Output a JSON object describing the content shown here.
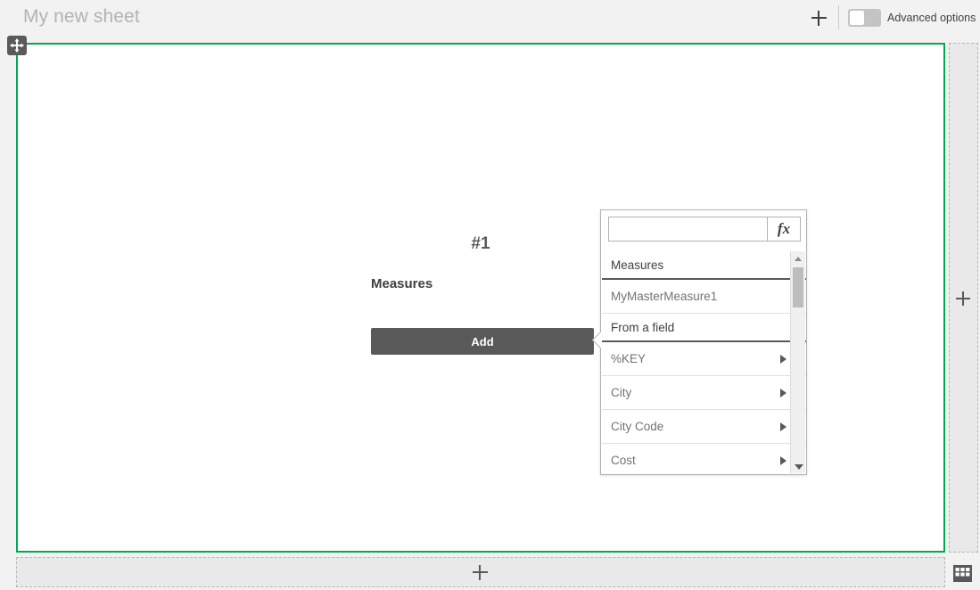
{
  "header": {
    "sheet_title": "My new sheet",
    "add_sheet_icon": "plus-icon",
    "advanced_options_label": "Advanced options",
    "advanced_options_state": "off"
  },
  "canvas": {
    "move_handle_icon": "move-arrows-icon",
    "border_color": "#00a94f",
    "object": {
      "title": "#1",
      "section_label": "Measures",
      "add_button_label": "Add"
    }
  },
  "dropzones": {
    "right_label": "+",
    "bottom_label": "+",
    "right_icon": "plus-icon",
    "bottom_icon": "plus-icon"
  },
  "footer": {
    "grid_icon": "grid-table-icon"
  },
  "popover": {
    "search_value": "",
    "search_placeholder": "",
    "expression_button_label": "fx",
    "expression_button_icon": "fx-icon",
    "scroll_up_icon": "chevron-up-icon",
    "scroll_down_icon": "chevron-down-icon",
    "sections": [
      {
        "header": "Measures",
        "items": [
          {
            "label": "MyMasterMeasure1",
            "has_arrow": false
          }
        ]
      },
      {
        "header": "From a field",
        "items": [
          {
            "label": "%KEY",
            "has_arrow": true
          },
          {
            "label": "City",
            "has_arrow": true
          },
          {
            "label": "City Code",
            "has_arrow": true
          },
          {
            "label": "Cost",
            "has_arrow": true
          }
        ]
      }
    ]
  }
}
